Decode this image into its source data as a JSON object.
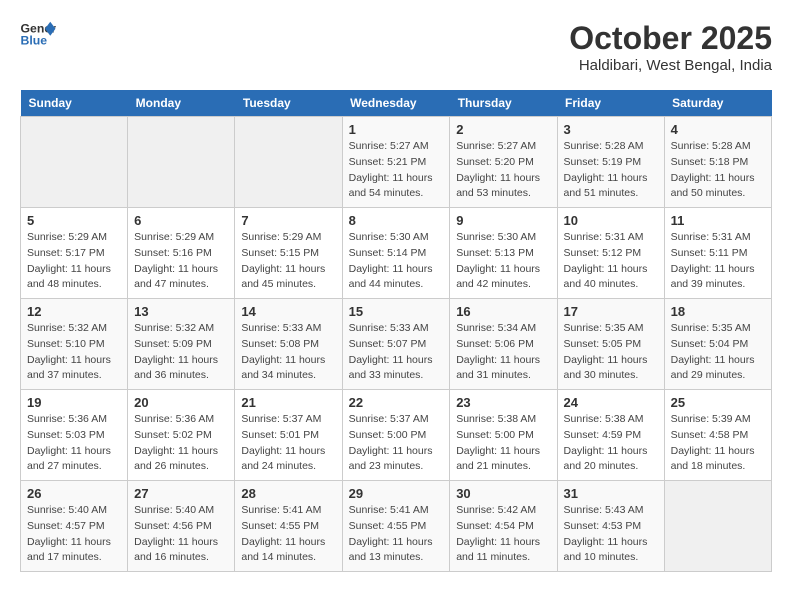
{
  "header": {
    "logo_line1": "General",
    "logo_line2": "Blue",
    "month": "October 2025",
    "location": "Haldibari, West Bengal, India"
  },
  "weekdays": [
    "Sunday",
    "Monday",
    "Tuesday",
    "Wednesday",
    "Thursday",
    "Friday",
    "Saturday"
  ],
  "weeks": [
    [
      {
        "day": "",
        "sunrise": "",
        "sunset": "",
        "daylight": ""
      },
      {
        "day": "",
        "sunrise": "",
        "sunset": "",
        "daylight": ""
      },
      {
        "day": "",
        "sunrise": "",
        "sunset": "",
        "daylight": ""
      },
      {
        "day": "1",
        "sunrise": "Sunrise: 5:27 AM",
        "sunset": "Sunset: 5:21 PM",
        "daylight": "Daylight: 11 hours and 54 minutes."
      },
      {
        "day": "2",
        "sunrise": "Sunrise: 5:27 AM",
        "sunset": "Sunset: 5:20 PM",
        "daylight": "Daylight: 11 hours and 53 minutes."
      },
      {
        "day": "3",
        "sunrise": "Sunrise: 5:28 AM",
        "sunset": "Sunset: 5:19 PM",
        "daylight": "Daylight: 11 hours and 51 minutes."
      },
      {
        "day": "4",
        "sunrise": "Sunrise: 5:28 AM",
        "sunset": "Sunset: 5:18 PM",
        "daylight": "Daylight: 11 hours and 50 minutes."
      }
    ],
    [
      {
        "day": "5",
        "sunrise": "Sunrise: 5:29 AM",
        "sunset": "Sunset: 5:17 PM",
        "daylight": "Daylight: 11 hours and 48 minutes."
      },
      {
        "day": "6",
        "sunrise": "Sunrise: 5:29 AM",
        "sunset": "Sunset: 5:16 PM",
        "daylight": "Daylight: 11 hours and 47 minutes."
      },
      {
        "day": "7",
        "sunrise": "Sunrise: 5:29 AM",
        "sunset": "Sunset: 5:15 PM",
        "daylight": "Daylight: 11 hours and 45 minutes."
      },
      {
        "day": "8",
        "sunrise": "Sunrise: 5:30 AM",
        "sunset": "Sunset: 5:14 PM",
        "daylight": "Daylight: 11 hours and 44 minutes."
      },
      {
        "day": "9",
        "sunrise": "Sunrise: 5:30 AM",
        "sunset": "Sunset: 5:13 PM",
        "daylight": "Daylight: 11 hours and 42 minutes."
      },
      {
        "day": "10",
        "sunrise": "Sunrise: 5:31 AM",
        "sunset": "Sunset: 5:12 PM",
        "daylight": "Daylight: 11 hours and 40 minutes."
      },
      {
        "day": "11",
        "sunrise": "Sunrise: 5:31 AM",
        "sunset": "Sunset: 5:11 PM",
        "daylight": "Daylight: 11 hours and 39 minutes."
      }
    ],
    [
      {
        "day": "12",
        "sunrise": "Sunrise: 5:32 AM",
        "sunset": "Sunset: 5:10 PM",
        "daylight": "Daylight: 11 hours and 37 minutes."
      },
      {
        "day": "13",
        "sunrise": "Sunrise: 5:32 AM",
        "sunset": "Sunset: 5:09 PM",
        "daylight": "Daylight: 11 hours and 36 minutes."
      },
      {
        "day": "14",
        "sunrise": "Sunrise: 5:33 AM",
        "sunset": "Sunset: 5:08 PM",
        "daylight": "Daylight: 11 hours and 34 minutes."
      },
      {
        "day": "15",
        "sunrise": "Sunrise: 5:33 AM",
        "sunset": "Sunset: 5:07 PM",
        "daylight": "Daylight: 11 hours and 33 minutes."
      },
      {
        "day": "16",
        "sunrise": "Sunrise: 5:34 AM",
        "sunset": "Sunset: 5:06 PM",
        "daylight": "Daylight: 11 hours and 31 minutes."
      },
      {
        "day": "17",
        "sunrise": "Sunrise: 5:35 AM",
        "sunset": "Sunset: 5:05 PM",
        "daylight": "Daylight: 11 hours and 30 minutes."
      },
      {
        "day": "18",
        "sunrise": "Sunrise: 5:35 AM",
        "sunset": "Sunset: 5:04 PM",
        "daylight": "Daylight: 11 hours and 29 minutes."
      }
    ],
    [
      {
        "day": "19",
        "sunrise": "Sunrise: 5:36 AM",
        "sunset": "Sunset: 5:03 PM",
        "daylight": "Daylight: 11 hours and 27 minutes."
      },
      {
        "day": "20",
        "sunrise": "Sunrise: 5:36 AM",
        "sunset": "Sunset: 5:02 PM",
        "daylight": "Daylight: 11 hours and 26 minutes."
      },
      {
        "day": "21",
        "sunrise": "Sunrise: 5:37 AM",
        "sunset": "Sunset: 5:01 PM",
        "daylight": "Daylight: 11 hours and 24 minutes."
      },
      {
        "day": "22",
        "sunrise": "Sunrise: 5:37 AM",
        "sunset": "Sunset: 5:00 PM",
        "daylight": "Daylight: 11 hours and 23 minutes."
      },
      {
        "day": "23",
        "sunrise": "Sunrise: 5:38 AM",
        "sunset": "Sunset: 5:00 PM",
        "daylight": "Daylight: 11 hours and 21 minutes."
      },
      {
        "day": "24",
        "sunrise": "Sunrise: 5:38 AM",
        "sunset": "Sunset: 4:59 PM",
        "daylight": "Daylight: 11 hours and 20 minutes."
      },
      {
        "day": "25",
        "sunrise": "Sunrise: 5:39 AM",
        "sunset": "Sunset: 4:58 PM",
        "daylight": "Daylight: 11 hours and 18 minutes."
      }
    ],
    [
      {
        "day": "26",
        "sunrise": "Sunrise: 5:40 AM",
        "sunset": "Sunset: 4:57 PM",
        "daylight": "Daylight: 11 hours and 17 minutes."
      },
      {
        "day": "27",
        "sunrise": "Sunrise: 5:40 AM",
        "sunset": "Sunset: 4:56 PM",
        "daylight": "Daylight: 11 hours and 16 minutes."
      },
      {
        "day": "28",
        "sunrise": "Sunrise: 5:41 AM",
        "sunset": "Sunset: 4:55 PM",
        "daylight": "Daylight: 11 hours and 14 minutes."
      },
      {
        "day": "29",
        "sunrise": "Sunrise: 5:41 AM",
        "sunset": "Sunset: 4:55 PM",
        "daylight": "Daylight: 11 hours and 13 minutes."
      },
      {
        "day": "30",
        "sunrise": "Sunrise: 5:42 AM",
        "sunset": "Sunset: 4:54 PM",
        "daylight": "Daylight: 11 hours and 11 minutes."
      },
      {
        "day": "31",
        "sunrise": "Sunrise: 5:43 AM",
        "sunset": "Sunset: 4:53 PM",
        "daylight": "Daylight: 11 hours and 10 minutes."
      },
      {
        "day": "",
        "sunrise": "",
        "sunset": "",
        "daylight": ""
      }
    ]
  ]
}
